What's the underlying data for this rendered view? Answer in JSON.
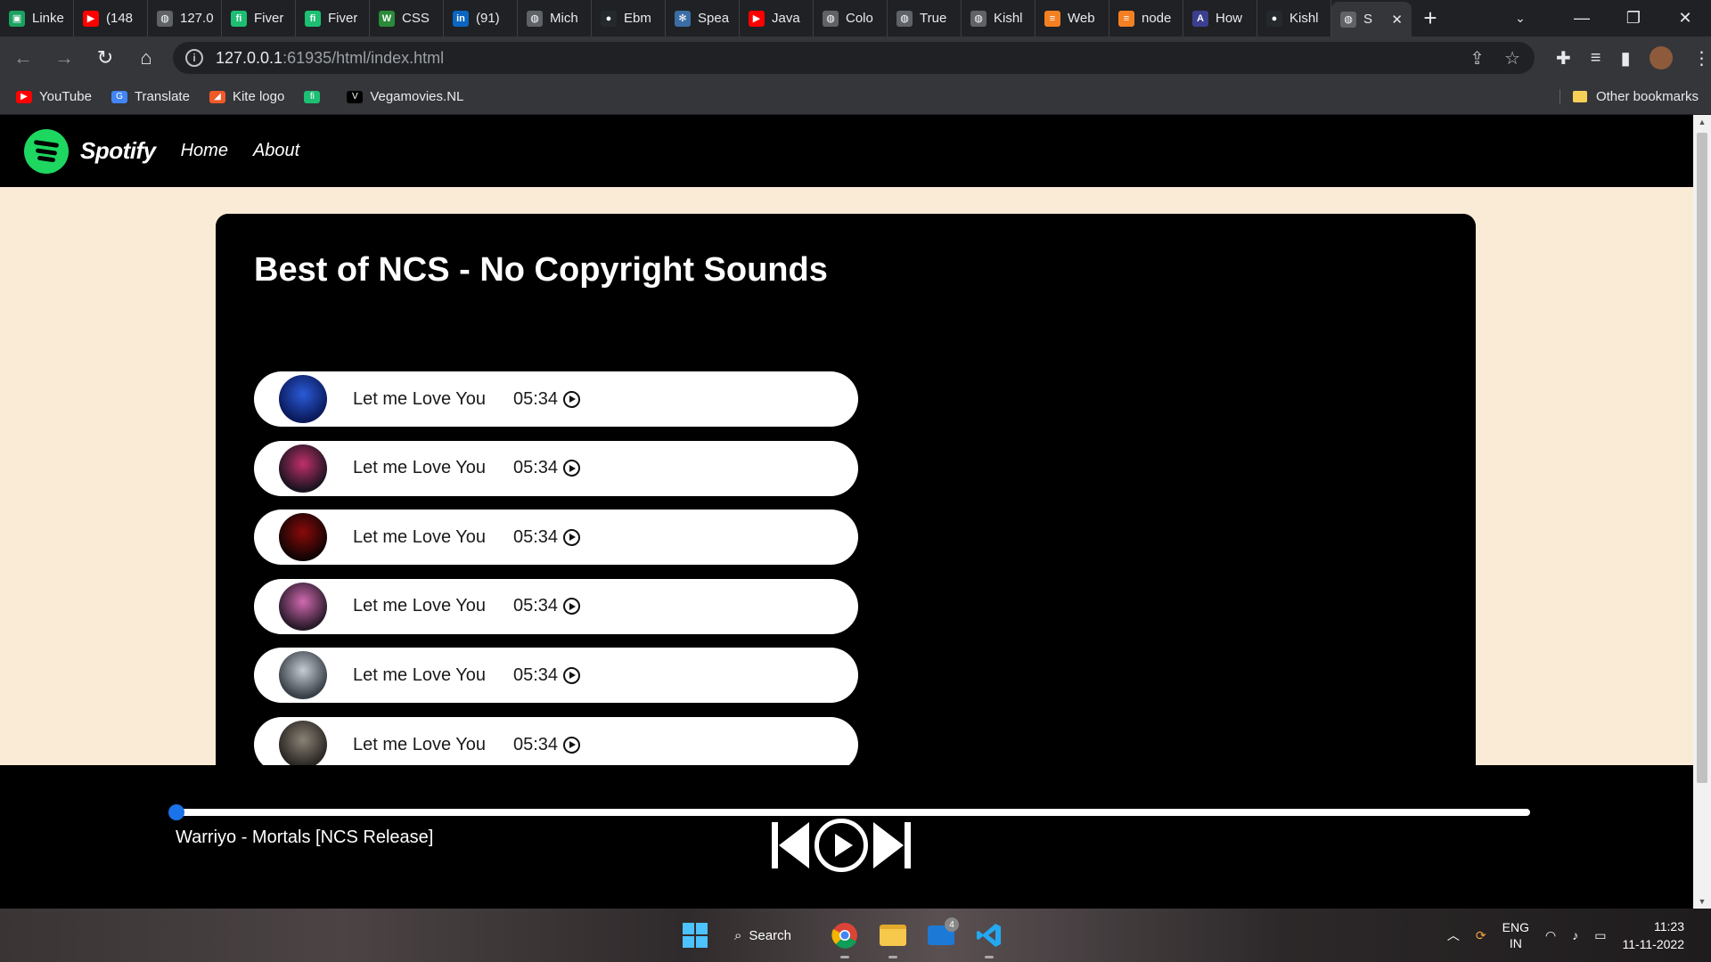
{
  "browser": {
    "tabs": [
      {
        "title": "Linke",
        "favicon_color": "#1aa260",
        "favicon_glyph": "▣"
      },
      {
        "title": "(148",
        "favicon_color": "#ff0000",
        "favicon_glyph": "▶"
      },
      {
        "title": "127.0",
        "favicon_color": "#5f6368",
        "favicon_glyph": "◍"
      },
      {
        "title": "Fiver",
        "favicon_color": "#1dbf73",
        "favicon_glyph": "fi"
      },
      {
        "title": "Fiver",
        "favicon_color": "#1dbf73",
        "favicon_glyph": "fi"
      },
      {
        "title": "CSS",
        "favicon_color": "#2a8a3a",
        "favicon_glyph": "W"
      },
      {
        "title": "(91)",
        "favicon_color": "#0a66c2",
        "favicon_glyph": "in"
      },
      {
        "title": "Mich",
        "favicon_color": "#5f6368",
        "favicon_glyph": "◍"
      },
      {
        "title": "Ebm",
        "favicon_color": "#24292e",
        "favicon_glyph": "●"
      },
      {
        "title": "Spea",
        "favicon_color": "#3b6ea5",
        "favicon_glyph": "✻"
      },
      {
        "title": "Java",
        "favicon_color": "#ff0000",
        "favicon_glyph": "▶"
      },
      {
        "title": "Colo",
        "favicon_color": "#5f6368",
        "favicon_glyph": "◍"
      },
      {
        "title": "True",
        "favicon_color": "#5f6368",
        "favicon_glyph": "◍"
      },
      {
        "title": "Kishl",
        "favicon_color": "#5f6368",
        "favicon_glyph": "◍"
      },
      {
        "title": "Web",
        "favicon_color": "#f48024",
        "favicon_glyph": "≡"
      },
      {
        "title": "node",
        "favicon_color": "#f48024",
        "favicon_glyph": "≡"
      },
      {
        "title": "How",
        "favicon_color": "#3b3f8f",
        "favicon_glyph": "A"
      },
      {
        "title": "Kishl",
        "favicon_color": "#24292e",
        "favicon_glyph": "●"
      }
    ],
    "active_tab": {
      "title": "S",
      "favicon_color": "#5f6368",
      "favicon_glyph": "◍"
    },
    "url_host": "127.0.0.1",
    "url_rest": ":61935/html/index.html",
    "bookmarks": [
      {
        "label": "YouTube",
        "color": "#ff0000",
        "glyph": "▶"
      },
      {
        "label": "Translate",
        "color": "#4285f4",
        "glyph": "G"
      },
      {
        "label": "Kite logo",
        "color": "#f05a28",
        "glyph": "◢"
      },
      {
        "label": "",
        "color": "#1dbf73",
        "glyph": "fi"
      },
      {
        "label": "Vegamovies.NL",
        "color": "#000000",
        "glyph": "V"
      }
    ],
    "other_bookmarks": "Other bookmarks"
  },
  "site": {
    "brand": "Spotify",
    "nav": [
      "Home",
      "About"
    ],
    "playlist_title": "Best of NCS - No Copyright Sounds",
    "songs": [
      {
        "name": "Let me Love You",
        "duration": "05:34",
        "cover_colors": [
          "#0b1a5c",
          "#2a5bd7"
        ]
      },
      {
        "name": "Let me Love You",
        "duration": "05:34",
        "cover_colors": [
          "#1c1420",
          "#c0306a"
        ]
      },
      {
        "name": "Let me Love You",
        "duration": "05:34",
        "cover_colors": [
          "#120404",
          "#8b0a0a"
        ]
      },
      {
        "name": "Let me Love You",
        "duration": "05:34",
        "cover_colors": [
          "#2a1a2a",
          "#d06ab0"
        ]
      },
      {
        "name": "Let me Love You",
        "duration": "05:34",
        "cover_colors": [
          "#3a4048",
          "#c4ccd4"
        ]
      },
      {
        "name": "Let me Love You",
        "duration": "05:34",
        "cover_colors": [
          "#2a2622",
          "#8a8276"
        ]
      }
    ],
    "player": {
      "now_playing": "Warriyo - Mortals [NCS Release]",
      "progress": 0.0,
      "accent": "#1a73e8"
    }
  },
  "taskbar": {
    "search_label": "Search",
    "mail_badge": "4",
    "lang_line1": "ENG",
    "lang_line2": "IN",
    "time": "11:23",
    "date": "11-11-2022"
  }
}
